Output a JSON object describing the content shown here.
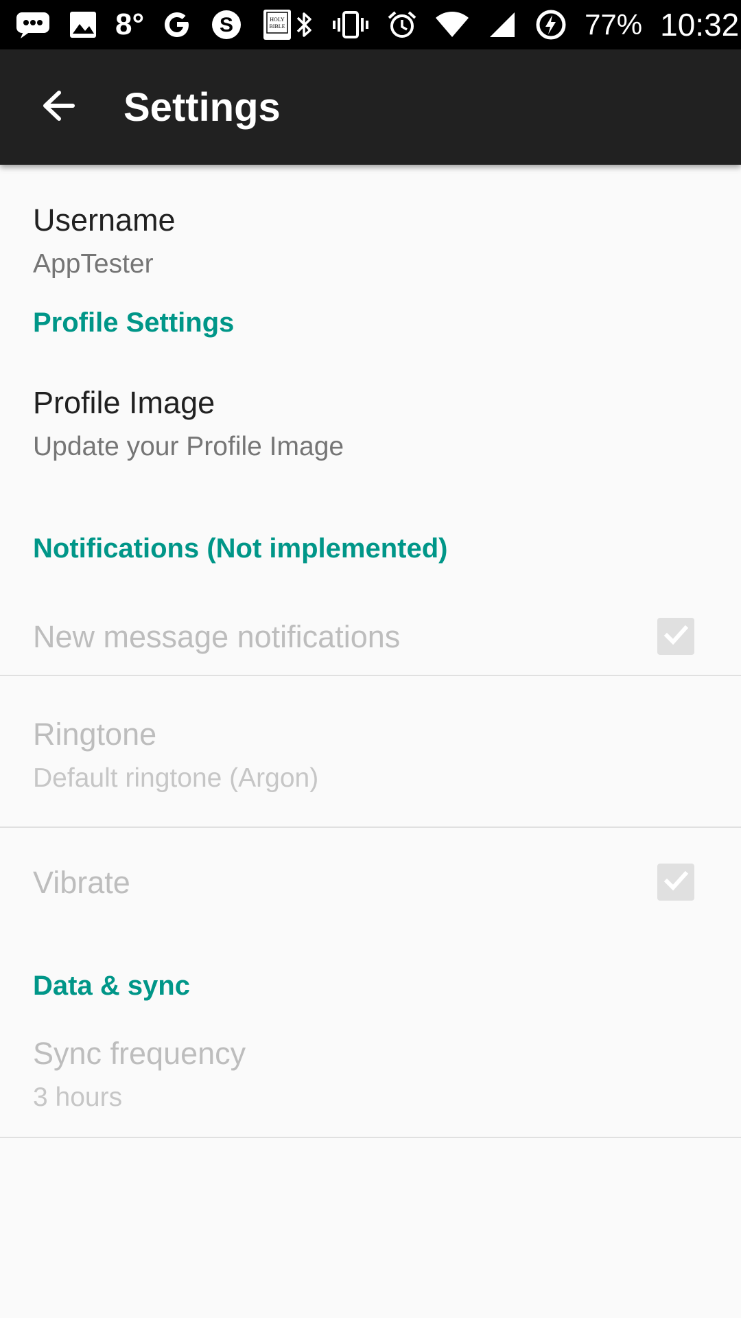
{
  "status_bar": {
    "temperature": "8°",
    "battery": "77%",
    "time": "10:32",
    "icons": [
      "messages-icon",
      "image-icon",
      "google-icon",
      "skype-icon",
      "holy-bible-icon",
      "bluetooth-icon",
      "vibrate-icon",
      "alarm-icon",
      "wifi-icon",
      "signal-icon",
      "battery-charging-icon"
    ],
    "bible_icon_text": "HOLY BIBLE"
  },
  "app_bar": {
    "back_icon": "arrow-back-icon",
    "title": "Settings"
  },
  "preferences": {
    "username": {
      "title": "Username",
      "summary": "AppTester"
    },
    "profile_category": "Profile Settings",
    "profile_image": {
      "title": "Profile Image",
      "summary": "Update your Profile Image"
    },
    "notifications_category": "Notifications (Not implemented)",
    "new_message_notifications": {
      "title": "New message notifications",
      "checked": true,
      "enabled": false
    },
    "ringtone": {
      "title": "Ringtone",
      "summary": "Default ringtone (Argon)",
      "enabled": false
    },
    "vibrate": {
      "title": "Vibrate",
      "checked": true,
      "enabled": false
    },
    "data_sync_category": "Data & sync",
    "sync_frequency": {
      "title": "Sync frequency",
      "summary": "3 hours",
      "enabled": false
    }
  },
  "colors": {
    "accent": "#009688",
    "app_bar": "#212121",
    "background": "#fafafa"
  }
}
